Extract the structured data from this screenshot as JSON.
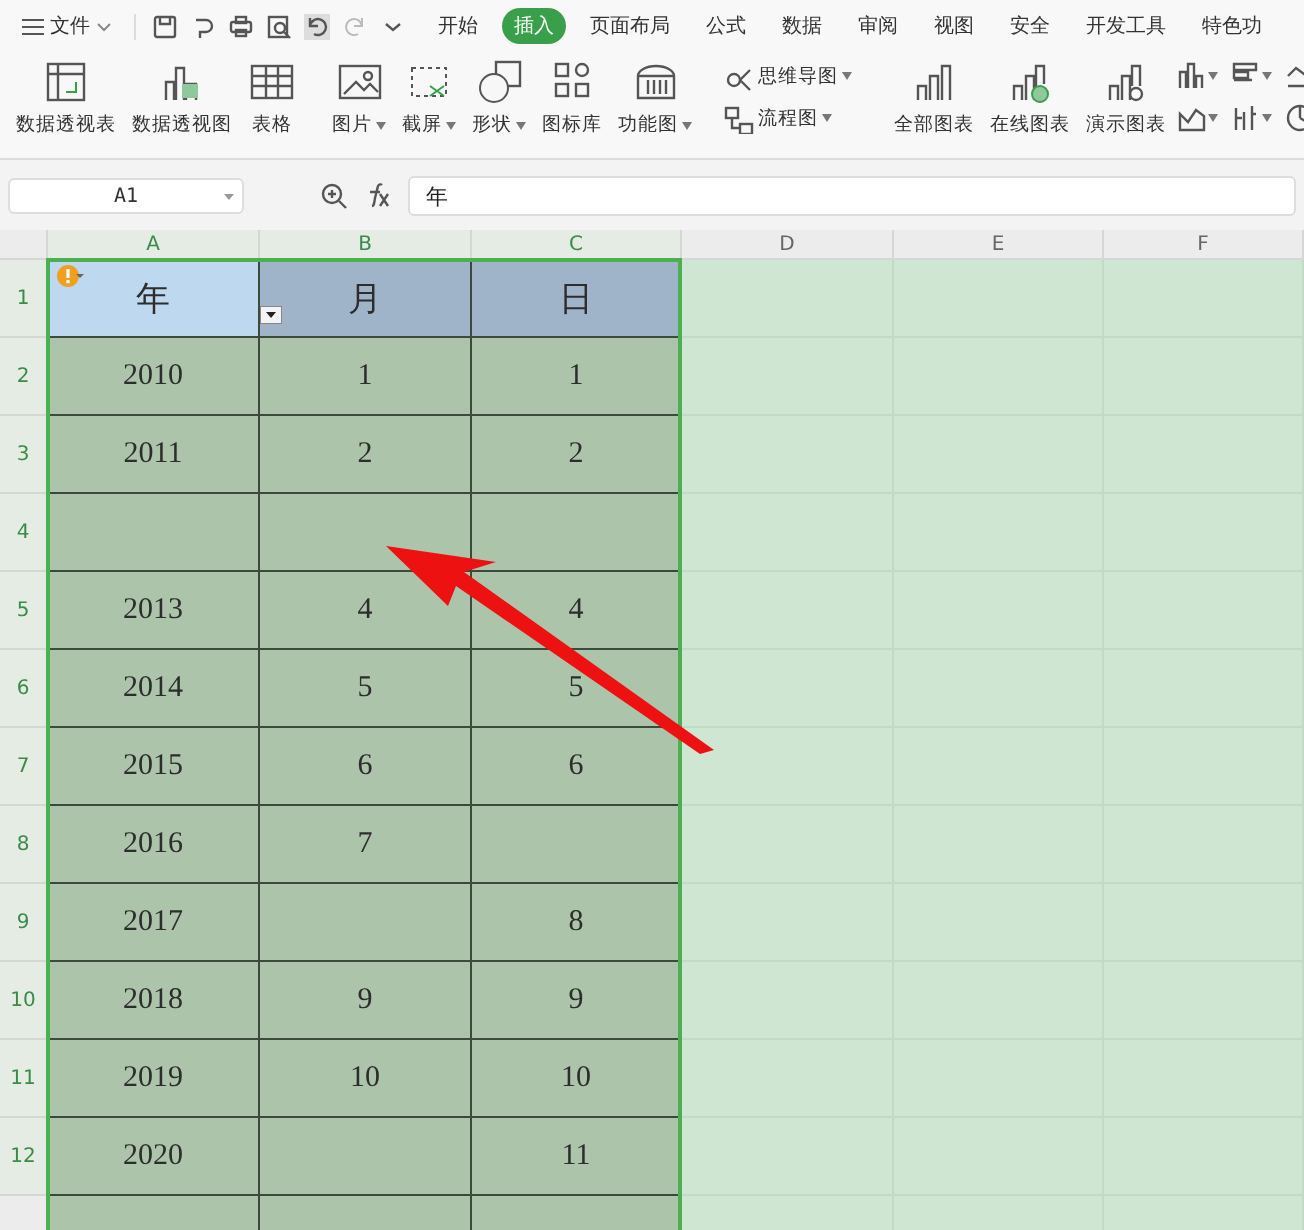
{
  "ribbon": {
    "menu": "文件",
    "tabs": [
      {
        "label": "开始",
        "selected": false
      },
      {
        "label": "插入",
        "selected": true
      },
      {
        "label": "页面布局",
        "selected": false
      },
      {
        "label": "公式",
        "selected": false
      },
      {
        "label": "数据",
        "selected": false
      },
      {
        "label": "审阅",
        "selected": false
      },
      {
        "label": "视图",
        "selected": false
      },
      {
        "label": "安全",
        "selected": false
      },
      {
        "label": "开发工具",
        "selected": false
      },
      {
        "label": "特色功",
        "selected": false
      }
    ],
    "tools": [
      {
        "label": "数据透视表",
        "kind": "large",
        "has_menu": false
      },
      {
        "label": "数据透视图",
        "kind": "large",
        "has_menu": false
      },
      {
        "label": "表格",
        "kind": "large",
        "has_menu": false
      },
      {
        "label": "图片",
        "kind": "large",
        "has_menu": true
      },
      {
        "label": "截屏",
        "kind": "large",
        "has_menu": true
      },
      {
        "label": "形状",
        "kind": "large",
        "has_menu": true
      },
      {
        "label": "图标库",
        "kind": "large",
        "has_menu": false
      },
      {
        "label": "功能图",
        "kind": "large",
        "has_menu": true
      },
      {
        "label": "思维导图",
        "kind": "small",
        "has_menu": true
      },
      {
        "label": "流程图",
        "kind": "small",
        "has_menu": true
      },
      {
        "label": "全部图表",
        "kind": "large",
        "has_menu": false
      },
      {
        "label": "在线图表",
        "kind": "large",
        "has_menu": false
      },
      {
        "label": "演示图表",
        "kind": "large",
        "has_menu": false
      }
    ]
  },
  "formula_bar": {
    "cell_ref": "A1",
    "value": "年"
  },
  "sheet": {
    "columns": [
      {
        "label": "A",
        "selected": true
      },
      {
        "label": "B",
        "selected": true
      },
      {
        "label": "C",
        "selected": true
      },
      {
        "label": "D",
        "selected": false
      },
      {
        "label": "E",
        "selected": false
      },
      {
        "label": "F",
        "selected": false
      }
    ],
    "rows": [
      {
        "number": "1",
        "selected": true,
        "cells": [
          "年",
          "月",
          "日"
        ]
      },
      {
        "number": "2",
        "selected": true,
        "cells": [
          "2010",
          "1",
          "1"
        ]
      },
      {
        "number": "3",
        "selected": true,
        "cells": [
          "2011",
          "2",
          "2"
        ]
      },
      {
        "number": "4",
        "selected": true,
        "cells": []
      },
      {
        "number": "5",
        "selected": true,
        "cells": [
          "2013",
          "4",
          "4"
        ]
      },
      {
        "number": "6",
        "selected": true,
        "cells": [
          "2014",
          "5",
          "5"
        ]
      },
      {
        "number": "7",
        "selected": true,
        "cells": [
          "2015",
          "6",
          "6"
        ]
      },
      {
        "number": "8",
        "selected": true,
        "cells": [
          "2016",
          "7",
          null
        ]
      },
      {
        "number": "9",
        "selected": true,
        "cells": [
          "2017",
          null,
          "8"
        ]
      },
      {
        "number": "10",
        "selected": true,
        "cells": [
          "2018",
          "9",
          "9"
        ]
      },
      {
        "number": "11",
        "selected": true,
        "cells": [
          "2019",
          "10",
          "10"
        ]
      },
      {
        "number": "12",
        "selected": true,
        "cells": [
          "2020",
          null,
          "11"
        ]
      }
    ]
  }
}
